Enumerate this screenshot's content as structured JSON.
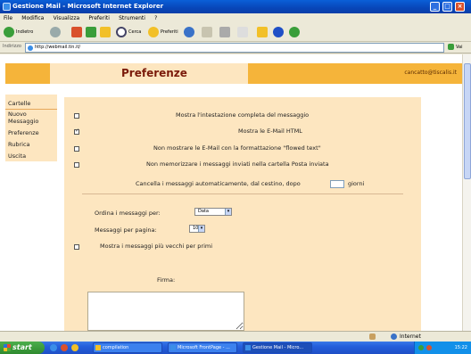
{
  "window": {
    "title": "Gestione Mail - Microsoft Internet Explorer",
    "controls": [
      "_",
      "□",
      "×"
    ]
  },
  "menu": [
    "File",
    "Modifica",
    "Visualizza",
    "Preferiti",
    "Strumenti",
    "?"
  ],
  "toolbar": {
    "back_label": "Indietro",
    "search_label": "Cerca",
    "favorites_label": "Preferiti"
  },
  "address": {
    "label": "Indirizzo",
    "url": "http://webmail.tin.it/",
    "go_label": "Vai"
  },
  "page": {
    "title": "Preferenze",
    "user_email": "cancatto@tiscalis.it",
    "sidebar": [
      {
        "label": "Cartelle"
      },
      {
        "label": "Nuovo Messaggio"
      },
      {
        "label": "Preferenze"
      },
      {
        "label": "Rubrica"
      },
      {
        "label": "Uscita"
      }
    ],
    "options": [
      {
        "label": "Mostra l'intestazione completa del messaggio",
        "checked": false
      },
      {
        "label": "Mostra le E-Mail HTML",
        "checked": true
      },
      {
        "label": "Non mostrare le E-Mail con la formattazione \"flowed text\"",
        "checked": false
      },
      {
        "label": "Non memorizzare i messaggi inviati nella cartella Posta inviata",
        "checked": false
      }
    ],
    "auto_delete": {
      "before": "Cancella i messaggi automaticamente, dal cestino, dopo",
      "after": "giorni",
      "value": ""
    },
    "sort": {
      "label": "Ordina i messaggi per:",
      "value": "Data"
    },
    "per_page": {
      "label": "Messaggi per pagina:",
      "value": "10"
    },
    "oldest_first": {
      "label": "Mostra i messaggi più vecchi per primi",
      "checked": false
    },
    "signature_label": "Firma:"
  },
  "statusbar": {
    "zone": "Internet"
  },
  "taskbar": {
    "start_label": "start",
    "buttons": [
      {
        "label": "compilation"
      },
      {
        "label": "Microsoft FrontPage - ..."
      },
      {
        "label": "Gestione Mail - Micro..."
      }
    ],
    "clock": "15:22"
  }
}
